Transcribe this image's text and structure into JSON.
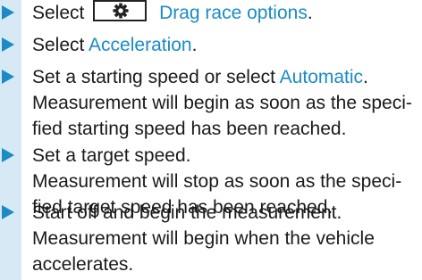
{
  "steps": [
    {
      "lines": [
        {
          "pre": "Select",
          "link": "Drag race options",
          "icon": "gear-icon"
        }
      ]
    },
    {
      "lines": [
        {
          "pre": "Select ",
          "link": "Acceleration",
          "post": "."
        }
      ]
    },
    {
      "lines": [
        {
          "pre": "Set a starting speed or select ",
          "link": "Automatic",
          "post": "."
        },
        {
          "text": "Measurement will begin as soon as the speci-"
        },
        {
          "text": "fied starting speed has been reached."
        }
      ]
    },
    {
      "lines": [
        {
          "text": "Set a target speed."
        },
        {
          "text": "Measurement will stop as soon as the speci-"
        },
        {
          "text": "fied target speed has been reached."
        }
      ]
    },
    {
      "lines": [
        {
          "text": "Start off and begin the measurement."
        },
        {
          "text": "Measurement will begin when the vehicle"
        },
        {
          "text": "accelerates."
        }
      ]
    }
  ],
  "step1_suffix": ".",
  "colors": {
    "accent": "#1a8bc4",
    "strip": "#d6e9f5",
    "text": "#1a1a1a"
  }
}
